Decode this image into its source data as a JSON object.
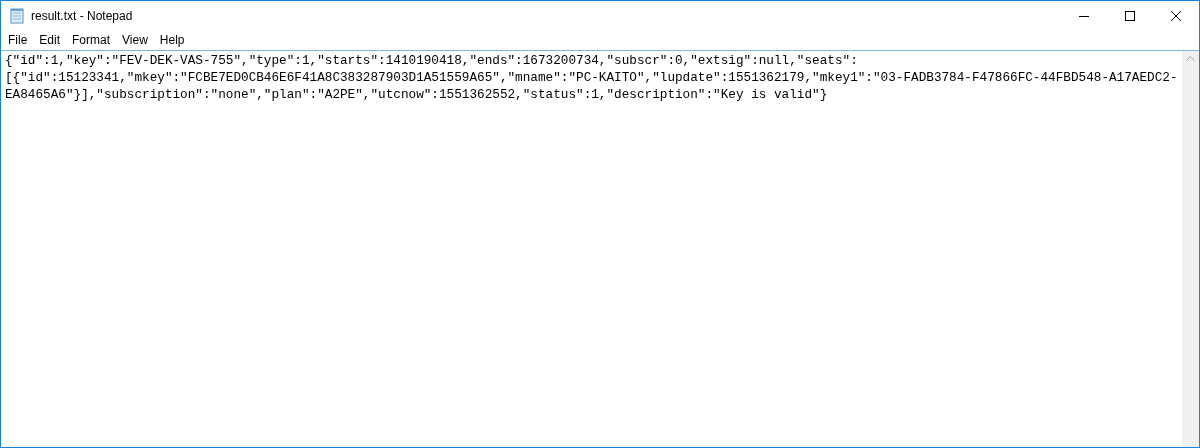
{
  "window": {
    "title": "result.txt - Notepad"
  },
  "menu": [
    {
      "label": "File"
    },
    {
      "label": "Edit"
    },
    {
      "label": "Format"
    },
    {
      "label": "View"
    },
    {
      "label": "Help"
    }
  ],
  "editor": {
    "lines": [
      "{\"id\":1,\"key\":\"FEV-DEK-VAS-755\",\"type\":1,\"starts\":1410190418,\"ends\":1673200734,\"subscr\":0,\"extsig\":null,\"seats\":",
      "[{\"id\":15123341,\"mkey\":\"FCBE7ED0CB46E6F41A8C383287903D1A51559A65\",\"mname\":\"PC-KAITO\",\"lupdate\":1551362179,\"mkey1\":\"03-FADB3784-F47866FC-44FBD548-A17AEDC2-",
      "EA8465A6\"}],\"subscription\":\"none\",\"plan\":\"A2PE\",\"utcnow\":1551362552,\"status\":1,\"description\":\"Key is valid\"}"
    ]
  }
}
